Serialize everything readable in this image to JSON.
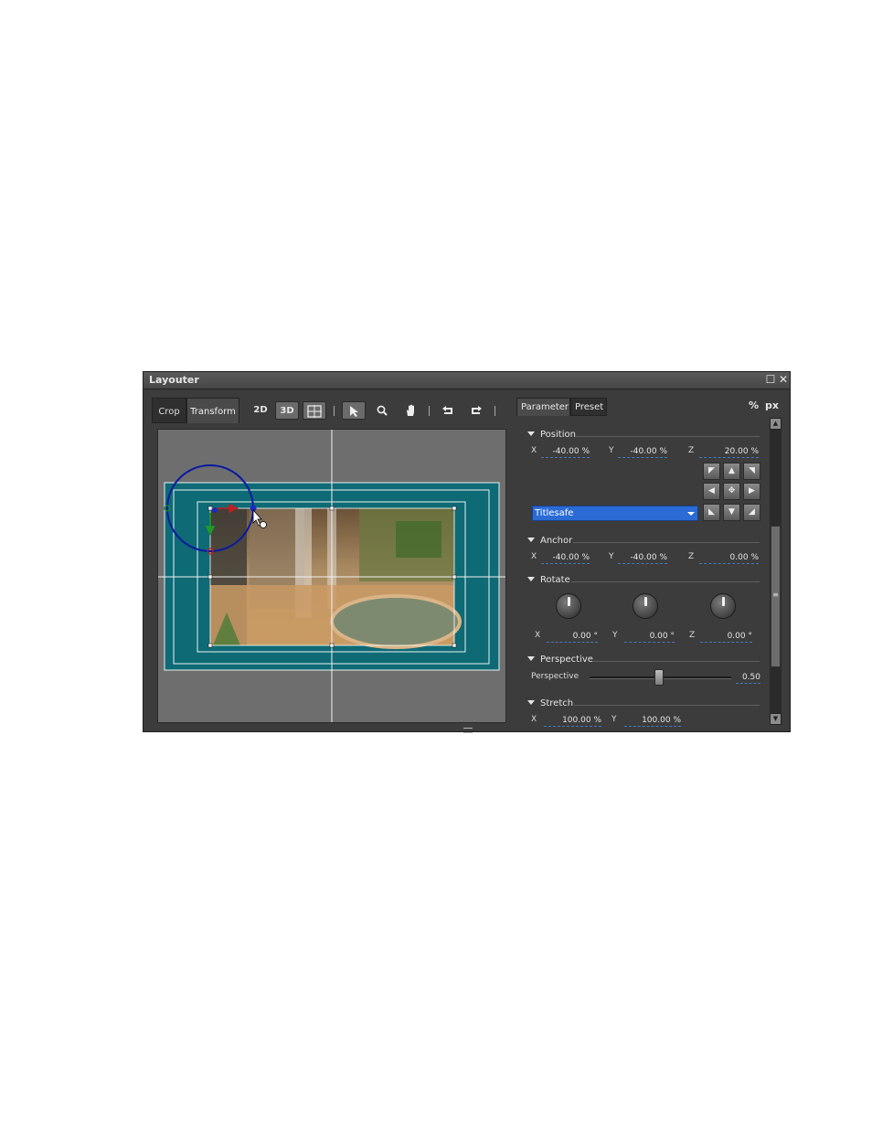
{
  "window": {
    "title": "Layouter"
  },
  "tabs": {
    "crop": "Crop",
    "transform": "Transform"
  },
  "toolbar": {
    "btn_2d": "2D",
    "btn_3d": "3D"
  },
  "right_tabs": {
    "parameter": "Parameter",
    "preset": "Preset"
  },
  "units": {
    "percent": "%",
    "px": "px"
  },
  "position": {
    "title": "Position",
    "x_label": "X",
    "x": "-40.00",
    "x_unit": "%",
    "y_label": "Y",
    "y": "-40.00",
    "y_unit": "%",
    "z_label": "Z",
    "z": "20.00",
    "z_unit": "%"
  },
  "safe_area": {
    "selected": "Titlesafe"
  },
  "anchor": {
    "title": "Anchor",
    "x_label": "X",
    "x": "-40.00",
    "x_unit": "%",
    "y_label": "Y",
    "y": "-40.00",
    "y_unit": "%",
    "z_label": "Z",
    "z": "0.00",
    "z_unit": "%"
  },
  "rotate": {
    "title": "Rotate",
    "x_label": "X",
    "x": "0.00",
    "x_unit": "°",
    "y_label": "Y",
    "y": "0.00",
    "y_unit": "°",
    "z_label": "Z",
    "z": "0.00",
    "z_unit": "°"
  },
  "perspective": {
    "title": "Perspective",
    "label": "Perspective",
    "value": "0.50"
  },
  "stretch": {
    "title": "Stretch",
    "x_label": "X",
    "x": "100.00",
    "x_unit": "%",
    "y_label": "Y",
    "y": "100.00",
    "y_unit": "%"
  },
  "colors": {
    "teal_area": "#0e6a74",
    "canvas": "#6e6e6e",
    "dropdown": "#2a6bd6",
    "rotation_circle": "#0a1aa0"
  },
  "icons": [
    "maximize-icon",
    "close-icon",
    "pointer-icon",
    "zoom-icon",
    "hand-icon",
    "undo-icon",
    "redo-icon"
  ]
}
